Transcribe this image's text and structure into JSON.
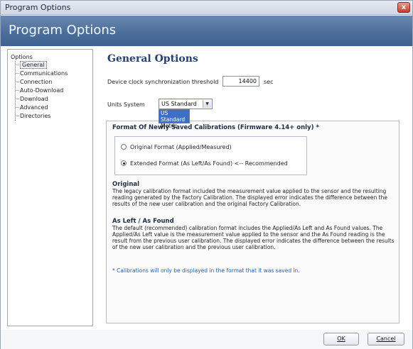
{
  "window": {
    "title": "Program Options",
    "close_symbol": "x"
  },
  "banner": {
    "title": "Program Options"
  },
  "nav": {
    "root": "Options",
    "items": [
      "General",
      "Communications",
      "Connection",
      "Auto-Download",
      "Download",
      "Advanced",
      "Directories"
    ],
    "selected": "General"
  },
  "general": {
    "heading": "General Options",
    "sync_label": "Device clock synchronization threshold",
    "sync_value": "14400",
    "sync_unit": "sec",
    "units_label": "Units System",
    "units_selected": "US Standard",
    "units_options": [
      "US Standard",
      "Metric"
    ],
    "units_highlighted": "US Standard"
  },
  "format": {
    "group_title": "Format Of Newly Saved Calibrations (Firmware 4.14+ only) *",
    "option_original": "Original Format (Applied/Measured)",
    "option_extended": "Extended Format (As Left/As Found) <-- Recommended",
    "selected": "extended",
    "original_title": "Original",
    "original_text": "The legacy calibration format included the measurement value applied to the sensor and the resulting reading generated by the Factory Calibration. The displayed error indicates the difference between the results of the new user calibration and the original Factory Calibration.",
    "asleft_title": "As Left / As Found",
    "asleft_text": "The default (recommended) calibration format includes the Applied/As Left and As Found values. The Applied/As Left value is the measurement value applied to the sensor and the As Found reading is the result from the previous user calibration. The displayed error indicates the difference between the results of the new user calibration and the previous user calibration.",
    "note": "* Calibrations will only be displayed in the format that it was saved in."
  },
  "footer": {
    "ok_label": "OK",
    "cancel_label": "Cancel"
  }
}
